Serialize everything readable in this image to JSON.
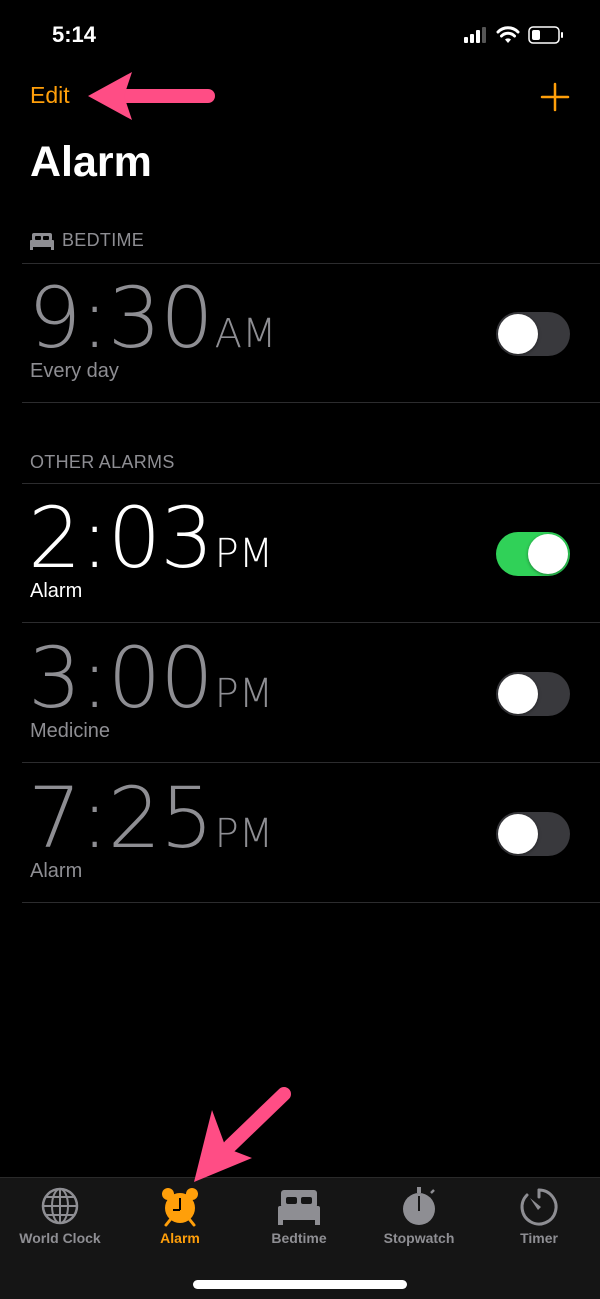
{
  "status_bar": {
    "time": "5:14",
    "icons": [
      "cellular-signal-icon",
      "wifi-icon",
      "battery-icon"
    ]
  },
  "nav": {
    "edit_label": "Edit",
    "add_icon": "plus-icon",
    "title": "Alarm"
  },
  "bedtime_section": {
    "header": "BEDTIME",
    "icon": "bed-icon",
    "alarm": {
      "time": "9:30",
      "period": "AM",
      "label": "Every day",
      "enabled": false
    }
  },
  "other_section": {
    "header": "OTHER ALARMS",
    "alarms": [
      {
        "time": "2:03",
        "period": "PM",
        "label": "Alarm",
        "enabled": true
      },
      {
        "time": "3:00",
        "period": "PM",
        "label": "Medicine",
        "enabled": false
      },
      {
        "time": "7:25",
        "period": "PM",
        "label": "Alarm",
        "enabled": false
      }
    ]
  },
  "tab_bar": {
    "tabs": [
      {
        "label": "World Clock",
        "icon": "globe-icon",
        "active": false
      },
      {
        "label": "Alarm",
        "icon": "alarm-clock-icon",
        "active": true
      },
      {
        "label": "Bedtime",
        "icon": "bed-icon",
        "active": false
      },
      {
        "label": "Stopwatch",
        "icon": "stopwatch-icon",
        "active": false
      },
      {
        "label": "Timer",
        "icon": "timer-icon",
        "active": false
      }
    ]
  },
  "colors": {
    "accent": "#ff9f0a",
    "toggle_on": "#30d158",
    "annotation_arrow": "#ff4d85"
  }
}
